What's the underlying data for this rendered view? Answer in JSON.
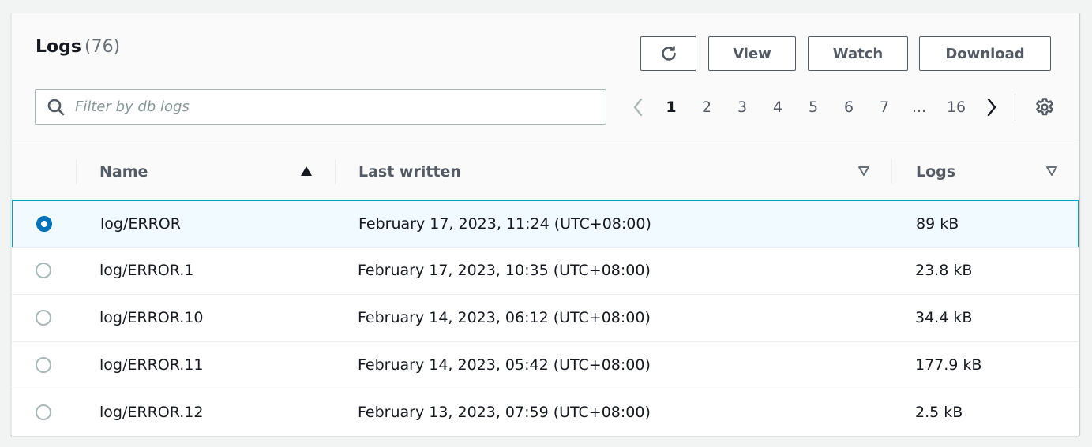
{
  "header": {
    "title": "Logs",
    "count": "(76)"
  },
  "actions": {
    "refresh_icon": "refresh-icon",
    "view_label": "View",
    "watch_label": "Watch",
    "download_label": "Download"
  },
  "search": {
    "placeholder": "Filter by db logs",
    "value": ""
  },
  "pagination": {
    "current": "1",
    "pages": [
      "1",
      "2",
      "3",
      "4",
      "5",
      "6",
      "7",
      "...",
      "16"
    ],
    "prev_icon": "chevron-left-icon",
    "next_icon": "chevron-right-icon",
    "settings_icon": "gear-icon"
  },
  "table": {
    "columns": {
      "name": "Name",
      "last_written": "Last written",
      "logs": "Logs"
    },
    "sort": {
      "column": "name",
      "direction": "ascending"
    },
    "rows": [
      {
        "name": "log/ERROR",
        "last_written": "February 17, 2023, 11:24 (UTC+08:00)",
        "size": "89 kB",
        "selected": true
      },
      {
        "name": "log/ERROR.1",
        "last_written": "February 17, 2023, 10:35 (UTC+08:00)",
        "size": "23.8 kB",
        "selected": false
      },
      {
        "name": "log/ERROR.10",
        "last_written": "February 14, 2023, 06:12 (UTC+08:00)",
        "size": "34.4 kB",
        "selected": false
      },
      {
        "name": "log/ERROR.11",
        "last_written": "February 14, 2023, 05:42 (UTC+08:00)",
        "size": "177.9 kB",
        "selected": false
      },
      {
        "name": "log/ERROR.12",
        "last_written": "February 13, 2023, 07:59 (UTC+08:00)",
        "size": "2.5 kB",
        "selected": false
      }
    ]
  },
  "colors": {
    "accent": "#0073bb",
    "selected_row_bg": "#f1faff",
    "selected_row_border": "#00a1c9"
  }
}
